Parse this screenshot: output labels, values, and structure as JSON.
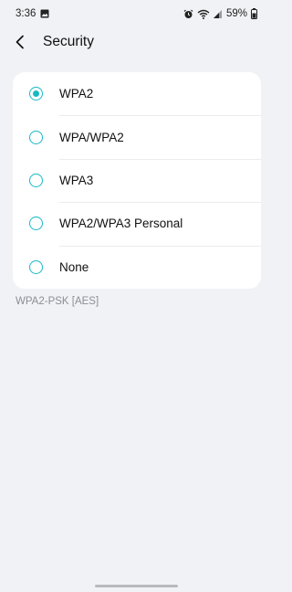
{
  "status_bar": {
    "time": "3:36",
    "battery": "59%",
    "icons": [
      "gallery-icon",
      "alarm-icon",
      "wifi-icon",
      "signal-icon",
      "battery-icon"
    ]
  },
  "header": {
    "back_icon": "chevron-left-icon",
    "title": "Security"
  },
  "options": [
    {
      "label": "WPA2",
      "selected": true
    },
    {
      "label": "WPA/WPA2",
      "selected": false
    },
    {
      "label": "WPA3",
      "selected": false
    },
    {
      "label": "WPA2/WPA3 Personal",
      "selected": false
    },
    {
      "label": "None",
      "selected": false
    }
  ],
  "note": "WPA2-PSK [AES]",
  "colors": {
    "accent": "#18b8c5",
    "background": "#f1f2f6",
    "card": "#ffffff",
    "note_text": "#8d8e93"
  }
}
